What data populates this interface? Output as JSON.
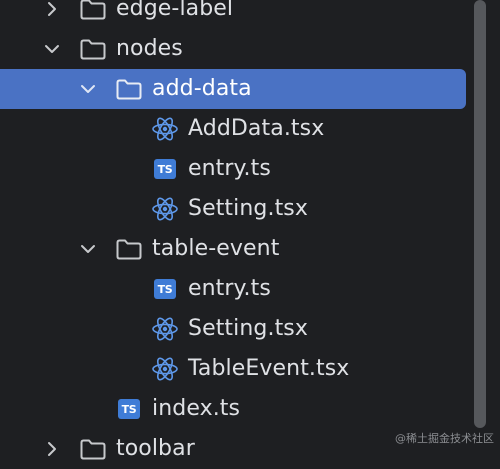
{
  "colors": {
    "background": "#1e1f22",
    "selection": "#4a72c4",
    "text": "#dfe1e5",
    "ts_badge": "#3f7cd6",
    "react_icon": "#5e98ea",
    "folder_outline": "#c7c9cc",
    "scrollbar_thumb": "#56585c"
  },
  "tree": {
    "items": [
      {
        "label": "edge-label",
        "icon": "folder-icon",
        "expanded": false
      },
      {
        "label": "nodes",
        "icon": "folder-icon",
        "expanded": true
      },
      {
        "label": "add-data",
        "icon": "folder-icon",
        "expanded": true,
        "selected": true
      },
      {
        "label": "AddData.tsx",
        "icon": "react-icon"
      },
      {
        "label": "entry.ts",
        "icon": "typescript-icon",
        "badge": "TS"
      },
      {
        "label": "Setting.tsx",
        "icon": "react-icon"
      },
      {
        "label": "table-event",
        "icon": "folder-icon",
        "expanded": true
      },
      {
        "label": "entry.ts",
        "icon": "typescript-icon",
        "badge": "TS"
      },
      {
        "label": "Setting.tsx",
        "icon": "react-icon"
      },
      {
        "label": "TableEvent.tsx",
        "icon": "react-icon"
      },
      {
        "label": "index.ts",
        "icon": "typescript-icon",
        "badge": "TS"
      },
      {
        "label": "toolbar",
        "icon": "folder-icon",
        "expanded": false
      }
    ]
  },
  "watermark": "@稀土掘金技术社区"
}
